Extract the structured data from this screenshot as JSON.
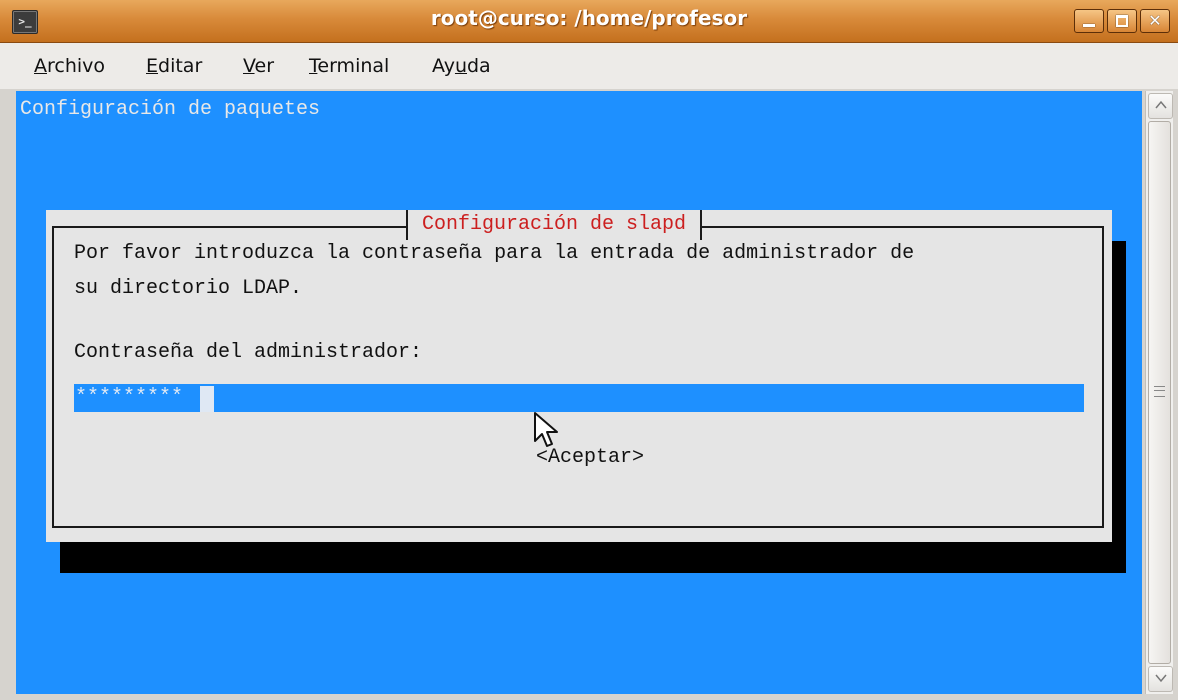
{
  "window": {
    "title": "root@curso: /home/profesor",
    "icon": "terminal-icon",
    "controls": [
      "minimize-icon",
      "maximize-icon",
      "close-icon"
    ],
    "close_glyph": "✕"
  },
  "menu": {
    "items": [
      {
        "label": "Archivo"
      },
      {
        "label": "Editar"
      },
      {
        "label": "Ver"
      },
      {
        "label": "Terminal"
      },
      {
        "label": "Ayuda"
      }
    ]
  },
  "terminal": {
    "background": "#1e90ff",
    "header": "Configuración de paquetes",
    "dialog": {
      "title": "Configuración de slapd",
      "title_color": "#cc1f1f",
      "line1": "Por favor introduzca la contraseña para la entrada de administrador de",
      "line2": "su directorio LDAP.",
      "prompt": "Contraseña del administrador:",
      "password_value": "*********",
      "ok_button": "<Aceptar>"
    }
  },
  "colors": {
    "titlebar": "#d88a3a",
    "dialog_bg": "#e5e5e5",
    "field_bg": "#1e90ff"
  }
}
